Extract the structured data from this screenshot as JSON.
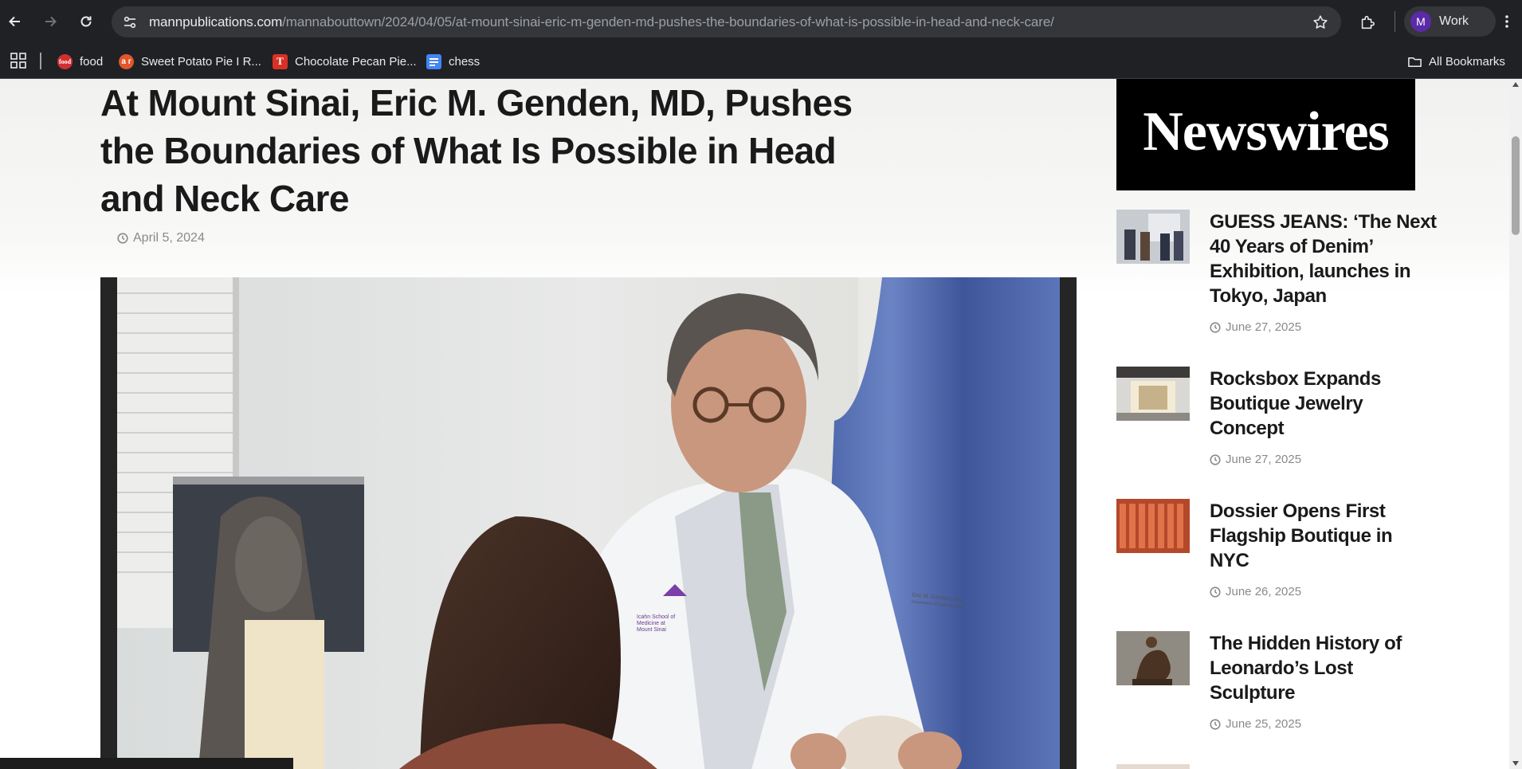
{
  "browser": {
    "url_domain": "mannpublications.com",
    "url_path": "/mannabouttown/2024/04/05/at-mount-sinai-eric-m-genden-md-pushes-the-boundaries-of-what-is-possible-in-head-and-neck-care/",
    "profile_initial": "M",
    "profile_name": "Work",
    "bookmarks": [
      {
        "label": "food",
        "icon": "food-favicon"
      },
      {
        "label": "Sweet Potato Pie I R...",
        "icon": "allrecipes-favicon"
      },
      {
        "label": "Chocolate Pecan Pie...",
        "icon": "nyt-favicon"
      },
      {
        "label": "chess",
        "icon": "google-docs-favicon"
      }
    ],
    "all_bookmarks_label": "All Bookmarks",
    "favicon_texts": {
      "food": "food",
      "sweet": "a r",
      "choc": "T"
    }
  },
  "article": {
    "title": "At Mount Sinai, Eric M. Genden, MD, Pushes the Boundaries of What Is Possible in Head and Neck Care",
    "date": "April 5, 2024",
    "image_alt": "Doctor in white coat with patient",
    "coat_name": "Eric M. Genden, MD",
    "coat_dept": "Department of Otolaryngology",
    "coat_logo_text": "Icahn School of Medicine at Mount Sinai"
  },
  "sidebar": {
    "banner": "Newswires",
    "items": [
      {
        "title": "GUESS JEANS: ‘The Next 40 Years of Denim’ Exhibition, launches in Tokyo, Japan",
        "date": "June 27, 2025"
      },
      {
        "title": "Rocksbox Expands Boutique Jewelry Concept",
        "date": "June 27, 2025"
      },
      {
        "title": "Dossier Opens First Flagship Boutique in NYC",
        "date": "June 26, 2025"
      },
      {
        "title": "The Hidden History of Leonardo’s Lost Sculpture",
        "date": "June 25, 2025"
      }
    ]
  },
  "colors": {
    "chrome_bg": "#202124",
    "omnibox_bg": "#35363a",
    "profile_avatar": "#5b2aa8",
    "banner_bg": "#000000",
    "title_text": "#1a1a1a",
    "date_text": "#8a8a8a"
  }
}
